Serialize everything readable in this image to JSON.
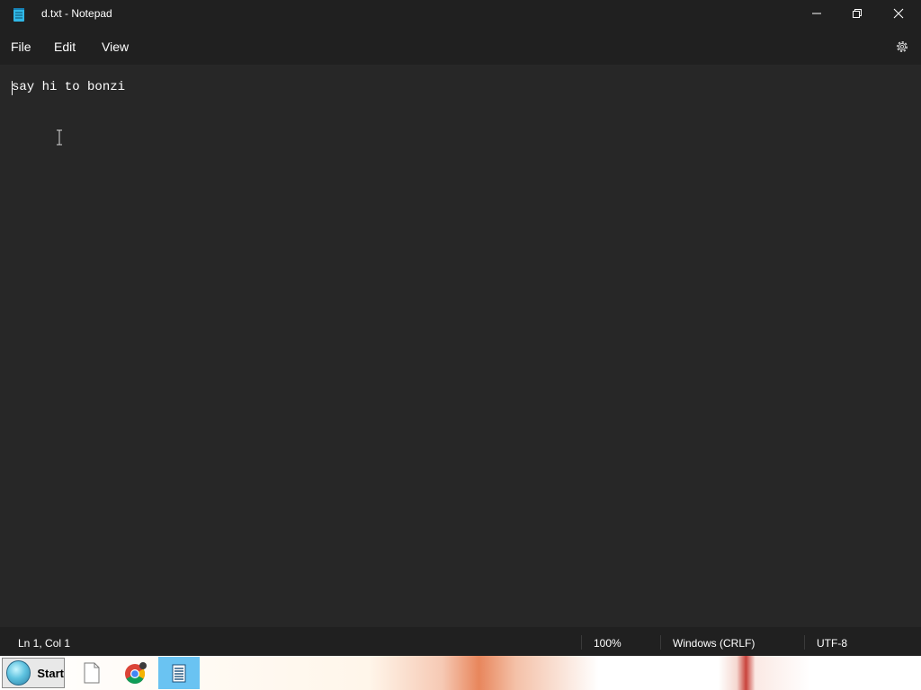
{
  "window": {
    "title": "d.txt - Notepad",
    "icon": "notepad-icon"
  },
  "menu": {
    "items": [
      "File",
      "Edit",
      "View"
    ],
    "settings_icon": "gear-icon"
  },
  "editor": {
    "content": "say hi to bonzi"
  },
  "status": {
    "position": "Ln 1, Col 1",
    "zoom": "100%",
    "line_ending": "Windows (CRLF)",
    "encoding": "UTF-8"
  },
  "taskbar": {
    "start_label": "Start",
    "items": [
      {
        "icon": "blank-file-icon"
      },
      {
        "icon": "chrome-icon"
      },
      {
        "icon": "notepad-icon",
        "active": true
      }
    ]
  },
  "colors": {
    "titlebar_bg": "#202020",
    "editor_bg": "#272727",
    "active_taskbar_item": "#6ac3f2"
  }
}
